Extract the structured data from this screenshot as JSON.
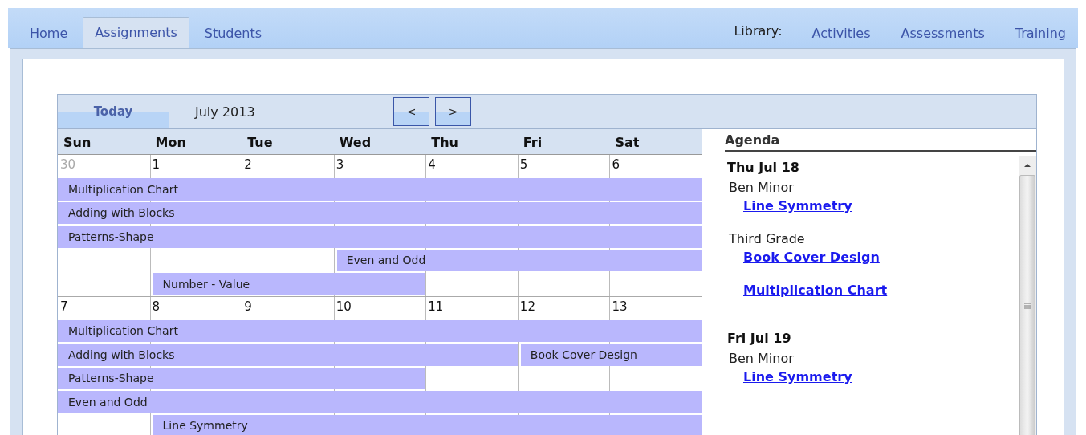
{
  "nav": {
    "tabs": [
      {
        "label": "Home",
        "selected": false
      },
      {
        "label": "Assignments",
        "selected": true
      },
      {
        "label": "Students",
        "selected": false
      }
    ],
    "library_label": "Library:",
    "library_links": [
      "Activities",
      "Assessments",
      "Training"
    ]
  },
  "calendar": {
    "today_button": "Today",
    "month": "July 2013",
    "prev_button": "<",
    "next_button": ">",
    "weekdays": [
      "Sun",
      "Mon",
      "Tue",
      "Wed",
      "Thu",
      "Fri",
      "Sat"
    ],
    "weeks": [
      {
        "days": [
          {
            "label": "30",
            "muted": true
          },
          {
            "label": "1",
            "muted": false
          },
          {
            "label": "2",
            "muted": false
          },
          {
            "label": "3",
            "muted": false
          },
          {
            "label": "4",
            "muted": false
          },
          {
            "label": "5",
            "muted": false
          },
          {
            "label": "6",
            "muted": false
          }
        ],
        "lanes": [
          [
            {
              "kind": "event",
              "title": "Multiplication Chart"
            },
            {
              "kind": "more"
            },
            {
              "kind": "more"
            },
            {
              "kind": "more"
            },
            {
              "kind": "more"
            },
            {
              "kind": "more"
            },
            {
              "kind": "more"
            }
          ],
          [
            {
              "kind": "event",
              "title": "Adding with Blocks"
            },
            {
              "kind": "more"
            },
            {
              "kind": "more"
            },
            {
              "kind": "more"
            },
            {
              "kind": "more"
            },
            {
              "kind": "more"
            },
            {
              "kind": "more"
            }
          ],
          [
            {
              "kind": "event",
              "title": "Patterns-Shape"
            },
            {
              "kind": "more"
            },
            {
              "kind": "more"
            },
            {
              "kind": "more"
            },
            {
              "kind": "more"
            },
            {
              "kind": "more"
            },
            {
              "kind": "more"
            }
          ],
          [
            {
              "kind": "empty"
            },
            {
              "kind": "empty"
            },
            {
              "kind": "empty"
            },
            {
              "kind": "event",
              "title": "Even and Odd"
            },
            {
              "kind": "more"
            },
            {
              "kind": "more"
            },
            {
              "kind": "more"
            }
          ],
          [
            {
              "kind": "empty"
            },
            {
              "kind": "event",
              "title": "Number - Value"
            },
            {
              "kind": "more"
            },
            {
              "kind": "more"
            },
            {
              "kind": "empty"
            },
            {
              "kind": "empty"
            },
            {
              "kind": "empty"
            }
          ]
        ]
      },
      {
        "days": [
          {
            "label": "7",
            "muted": false
          },
          {
            "label": "8",
            "muted": false
          },
          {
            "label": "9",
            "muted": false
          },
          {
            "label": "10",
            "muted": false
          },
          {
            "label": "11",
            "muted": false
          },
          {
            "label": "12",
            "muted": false
          },
          {
            "label": "13",
            "muted": false
          }
        ],
        "lanes": [
          [
            {
              "kind": "event",
              "title": "Multiplication Chart"
            },
            {
              "kind": "more"
            },
            {
              "kind": "more"
            },
            {
              "kind": "more"
            },
            {
              "kind": "more"
            },
            {
              "kind": "more"
            },
            {
              "kind": "more"
            }
          ],
          [
            {
              "kind": "event",
              "title": "Adding with Blocks"
            },
            {
              "kind": "more"
            },
            {
              "kind": "more"
            },
            {
              "kind": "more"
            },
            {
              "kind": "more"
            },
            {
              "kind": "event",
              "title": "Book Cover Design"
            },
            {
              "kind": "more"
            }
          ],
          [
            {
              "kind": "event",
              "title": "Patterns-Shape"
            },
            {
              "kind": "more"
            },
            {
              "kind": "more"
            },
            {
              "kind": "more"
            },
            {
              "kind": "empty"
            },
            {
              "kind": "empty"
            },
            {
              "kind": "empty"
            }
          ],
          [
            {
              "kind": "event",
              "title": "Even and Odd"
            },
            {
              "kind": "more"
            },
            {
              "kind": "more"
            },
            {
              "kind": "more"
            },
            {
              "kind": "more"
            },
            {
              "kind": "more"
            },
            {
              "kind": "more"
            }
          ],
          [
            {
              "kind": "empty"
            },
            {
              "kind": "event",
              "title": "Line Symmetry"
            },
            {
              "kind": "more"
            },
            {
              "kind": "more"
            },
            {
              "kind": "more"
            },
            {
              "kind": "more"
            },
            {
              "kind": "more"
            }
          ]
        ]
      }
    ]
  },
  "agenda": {
    "title": "Agenda",
    "days": [
      {
        "date": "Thu Jul 18",
        "groups": [
          {
            "name": "Ben Minor",
            "links": [
              "Line Symmetry"
            ]
          },
          {
            "name": "Third Grade",
            "links": [
              "Book Cover Design",
              "Multiplication Chart"
            ]
          }
        ]
      },
      {
        "date": "Fri Jul 19",
        "groups": [
          {
            "name": "Ben Minor",
            "links": [
              "Line Symmetry"
            ]
          }
        ]
      }
    ]
  }
}
